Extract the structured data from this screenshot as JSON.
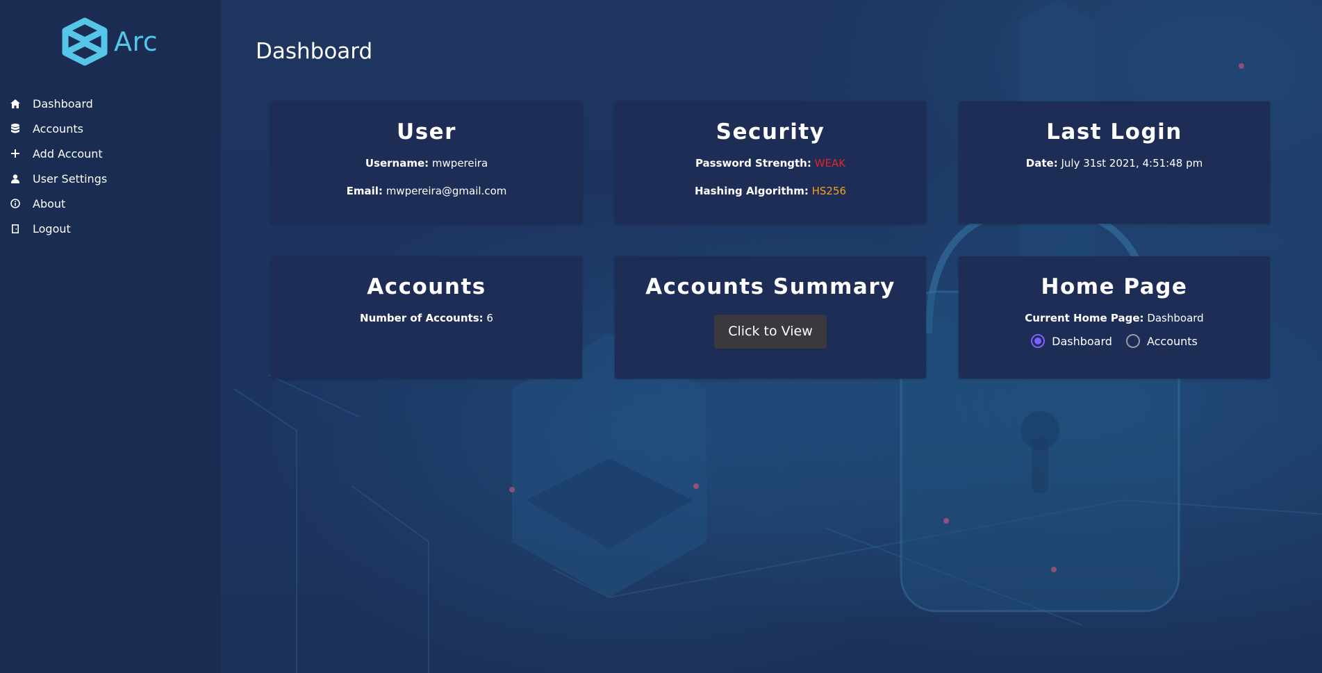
{
  "app": {
    "name": "Arc",
    "brand_color": "#55c6e8"
  },
  "sidebar": {
    "items": [
      {
        "label": "Dashboard",
        "icon": "home-icon"
      },
      {
        "label": "Accounts",
        "icon": "database-icon"
      },
      {
        "label": "Add Account",
        "icon": "plus-icon"
      },
      {
        "label": "User Settings",
        "icon": "user-icon"
      },
      {
        "label": "About",
        "icon": "info-icon"
      },
      {
        "label": "Logout",
        "icon": "door-icon"
      }
    ]
  },
  "page": {
    "title": "Dashboard"
  },
  "cards": {
    "user": {
      "title": "User",
      "username_label": "Username:",
      "username": "mwpereira",
      "email_label": "Email:",
      "email": "mwpereira@gmail.com"
    },
    "security": {
      "title": "Security",
      "strength_label": "Password Strength:",
      "strength": "WEAK",
      "strength_color": "#e0242a",
      "algo_label": "Hashing Algorithm:",
      "algo": "HS256",
      "algo_color": "#f5a11c"
    },
    "last_login": {
      "title": "Last Login",
      "date_label": "Date:",
      "date": "July 31st 2021, 4:51:48 pm"
    },
    "accounts": {
      "title": "Accounts",
      "count_label": "Number of Accounts:",
      "count": "6"
    },
    "summary": {
      "title": "Accounts Summary",
      "button_label": "Click to View"
    },
    "home_page": {
      "title": "Home Page",
      "current_label": "Current Home Page:",
      "current": "Dashboard",
      "options": [
        "Dashboard",
        "Accounts"
      ],
      "selected": "Dashboard",
      "accent": "#7b61ff"
    }
  }
}
